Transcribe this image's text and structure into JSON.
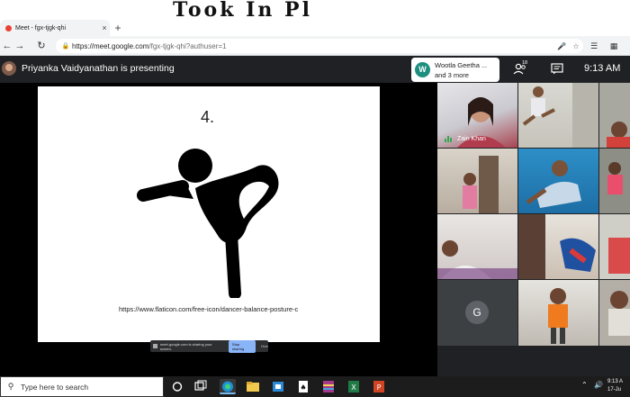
{
  "browser": {
    "tab_title": "Meet - fgx-tjgk-qhi",
    "tab_close": "×",
    "new_tab": "+",
    "url_host": "https://meet.google.com",
    "url_rest": "/fgx-tjgk-qhi?authuser=1",
    "back": "←",
    "forward": "→",
    "reload": "↻",
    "scrawl_text": "Took In Pl"
  },
  "meet": {
    "presenting_text": "Priyanka Vaidyanathan is presenting",
    "chip": {
      "initial": "W",
      "name": "Wootla Geetha ...",
      "more": "and 3 more"
    },
    "participant_count": "18",
    "clock": "9:13 AM"
  },
  "slide": {
    "number": "4.",
    "credit": "https://www.flaticon.com/free-icon/dancer-balance-posture-c",
    "share_msg": "meet.google.com is sharing your screen.",
    "stop_sharing": "Stop sharing",
    "hide": "Hide"
  },
  "grid": {
    "speaker_name": "Zain Khan",
    "g_initial": "G"
  },
  "taskbar": {
    "search_placeholder": "Type here to search",
    "time": "9:13 A",
    "date": "17-Ju"
  },
  "colors": {
    "meet_bg": "#202124",
    "accent_teal": "#1e8e7e",
    "speaking_green": "#34a853"
  }
}
